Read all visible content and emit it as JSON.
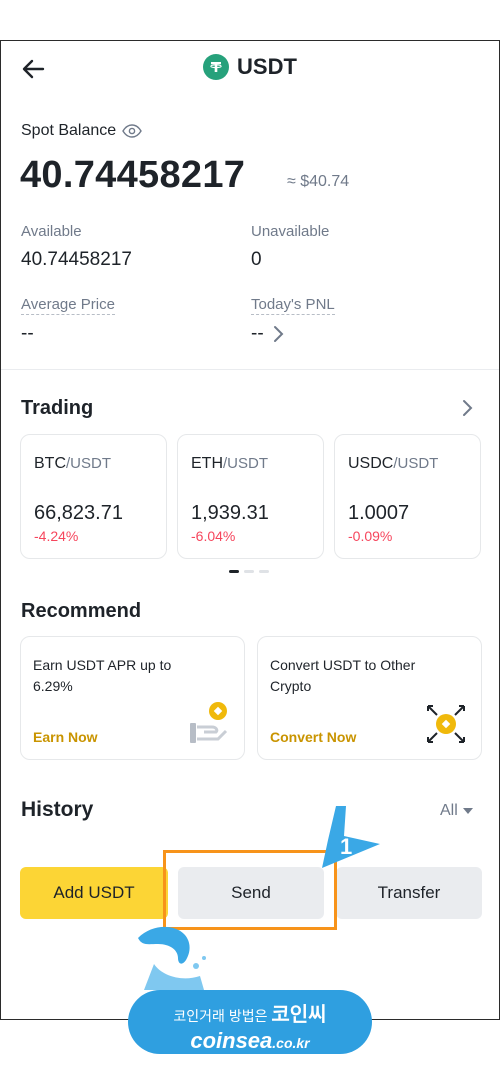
{
  "header": {
    "title": "USDT",
    "back_icon": "arrow-left-icon",
    "coin_icon": "tether-icon"
  },
  "balance": {
    "label": "Spot Balance",
    "value": "40.74458217",
    "approx": "≈ $40.74"
  },
  "stats": {
    "available_label": "Available",
    "available_value": "40.74458217",
    "unavailable_label": "Unavailable",
    "unavailable_value": "0",
    "avg_price_label": "Average Price",
    "avg_price_value": "--",
    "pnl_label": "Today's PNL",
    "pnl_value": "--"
  },
  "trading": {
    "title": "Trading",
    "pairs": [
      {
        "base": "BTC",
        "quote": "/USDT",
        "price": "66,823.71",
        "change": "-4.24%"
      },
      {
        "base": "ETH",
        "quote": "/USDT",
        "price": "1,939.31",
        "change": "-6.04%"
      },
      {
        "base": "USDC",
        "quote": "/USDT",
        "price": "1.0007",
        "change": "-0.09%"
      }
    ]
  },
  "recommend": {
    "title": "Recommend",
    "cards": [
      {
        "text": "Earn USDT APR up to 6.29%",
        "link": "Earn Now"
      },
      {
        "text": "Convert USDT to Other Crypto",
        "link": "Convert Now"
      }
    ]
  },
  "history": {
    "title": "History",
    "filter": "All"
  },
  "actions": {
    "add": "Add USDT",
    "send": "Send",
    "transfer": "Transfer"
  },
  "annotation": {
    "step": "1"
  },
  "watermark": {
    "line1_small": "코인거래 방법은",
    "line1_big": "코인씨",
    "line2": "coinsea",
    "line2_small": ".co.kr"
  },
  "colors": {
    "accent": "#fcd535",
    "negative": "#f6465d",
    "link": "#c99400",
    "highlight": "#f7931a",
    "callout": "#3aa8e6"
  }
}
